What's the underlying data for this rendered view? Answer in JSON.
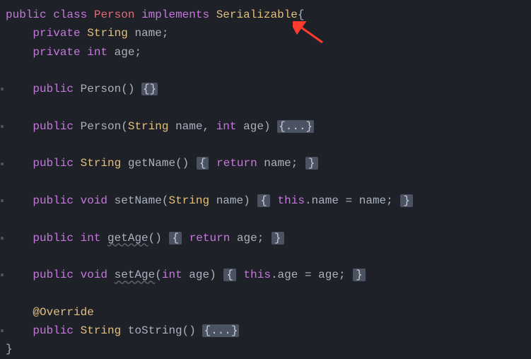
{
  "code": {
    "kw_public": "public",
    "kw_class": "class",
    "kw_implements": "implements",
    "kw_private": "private",
    "kw_void": "void",
    "kw_int": "int",
    "kw_return": "return",
    "kw_this": "this",
    "cls_person": "Person",
    "cls_serializable": "Serializable",
    "type_string": "String",
    "id_name": "name",
    "id_age": "age",
    "mtd_getname": "getName",
    "mtd_setname": "setName",
    "mtd_getage": "getAge",
    "mtd_setage": "setAge",
    "mtd_tostring": "toString",
    "anno_override": "@Override",
    "fold_empty": "{}",
    "fold_dots": "{...}",
    "brace_open": "{",
    "brace_close": "}",
    "assign_name": ".name = name;",
    "assign_age": ".age = age;",
    "ret_name": " name;",
    "ret_age": " age;"
  }
}
